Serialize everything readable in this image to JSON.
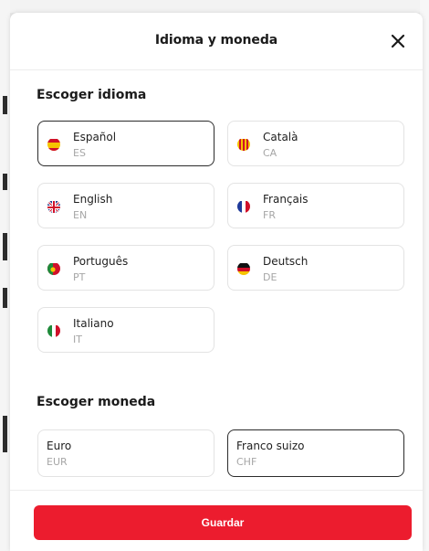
{
  "modal": {
    "title": "Idioma y moneda",
    "close_icon": "close-icon"
  },
  "language_section": {
    "title": "Escoger idioma",
    "selected": "ES",
    "items": [
      {
        "name": "Español",
        "code": "ES",
        "flag": "spain-flag-icon"
      },
      {
        "name": "Català",
        "code": "CA",
        "flag": "catalonia-flag-icon"
      },
      {
        "name": "English",
        "code": "EN",
        "flag": "uk-flag-icon"
      },
      {
        "name": "Français",
        "code": "FR",
        "flag": "france-flag-icon"
      },
      {
        "name": "Português",
        "code": "PT",
        "flag": "portugal-flag-icon"
      },
      {
        "name": "Deutsch",
        "code": "DE",
        "flag": "germany-flag-icon"
      },
      {
        "name": "Italiano",
        "code": "IT",
        "flag": "italy-flag-icon"
      }
    ]
  },
  "currency_section": {
    "title": "Escoger moneda",
    "selected": "CHF",
    "items": [
      {
        "name": "Euro",
        "code": "EUR"
      },
      {
        "name": "Franco suizo",
        "code": "CHF"
      }
    ]
  },
  "footer": {
    "save_label": "Guardar"
  },
  "colors": {
    "accent": "#ec1c2e",
    "selected_border": "#2b2b2b",
    "card_border": "#e3e3e3",
    "secondary_text": "#a6a6a6"
  }
}
